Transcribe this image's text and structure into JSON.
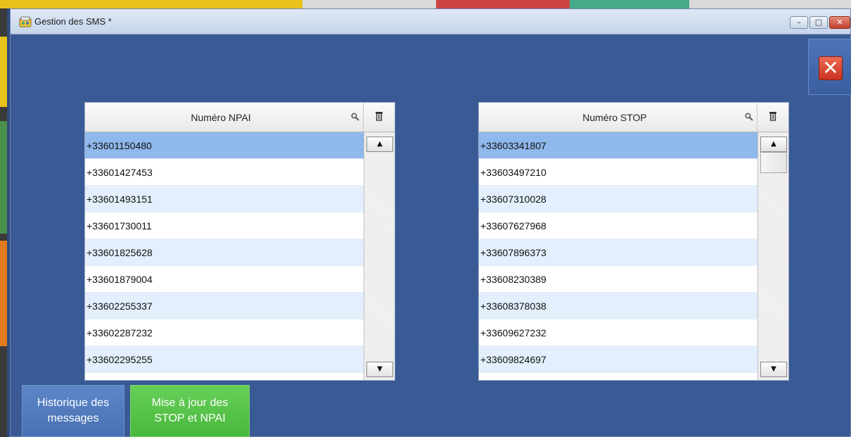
{
  "window": {
    "title": "Gestion des SMS *",
    "controls": {
      "minimize": "–",
      "maximize": "□",
      "close": "✕"
    }
  },
  "big_close": {
    "glyph": "✕"
  },
  "npai_table": {
    "header": "Numéro NPAI",
    "rows": [
      "+33601150480",
      "+33601427453",
      "+33601493151",
      "+33601730011",
      "+33601825628",
      "+33601879004",
      "+33602255337",
      "+33602287232",
      "+33602295255"
    ]
  },
  "stop_table": {
    "header": "Numéro STOP",
    "rows": [
      "+33603341807",
      "+33603497210",
      "+33607310028",
      "+33607627968",
      "+33607896373",
      "+33608230389",
      "+33608378038",
      "+33609627232",
      "+33609824697"
    ]
  },
  "scroll": {
    "up": "▲",
    "down": "▼"
  },
  "buttons": {
    "historique_line1": "Historique des",
    "historique_line2": "messages",
    "maj_line1": "Mise à jour des",
    "maj_line2": "STOP et NPAI"
  },
  "icons": {
    "search": "search-icon",
    "trash": "trash-icon",
    "app": "app-icon"
  },
  "colors": {
    "window_bg": "#3a5a96",
    "selected_row": "#8fb8ec",
    "alt_row": "#e3effc",
    "green_button": "#48b83c",
    "blue_button": "#4870b4"
  }
}
